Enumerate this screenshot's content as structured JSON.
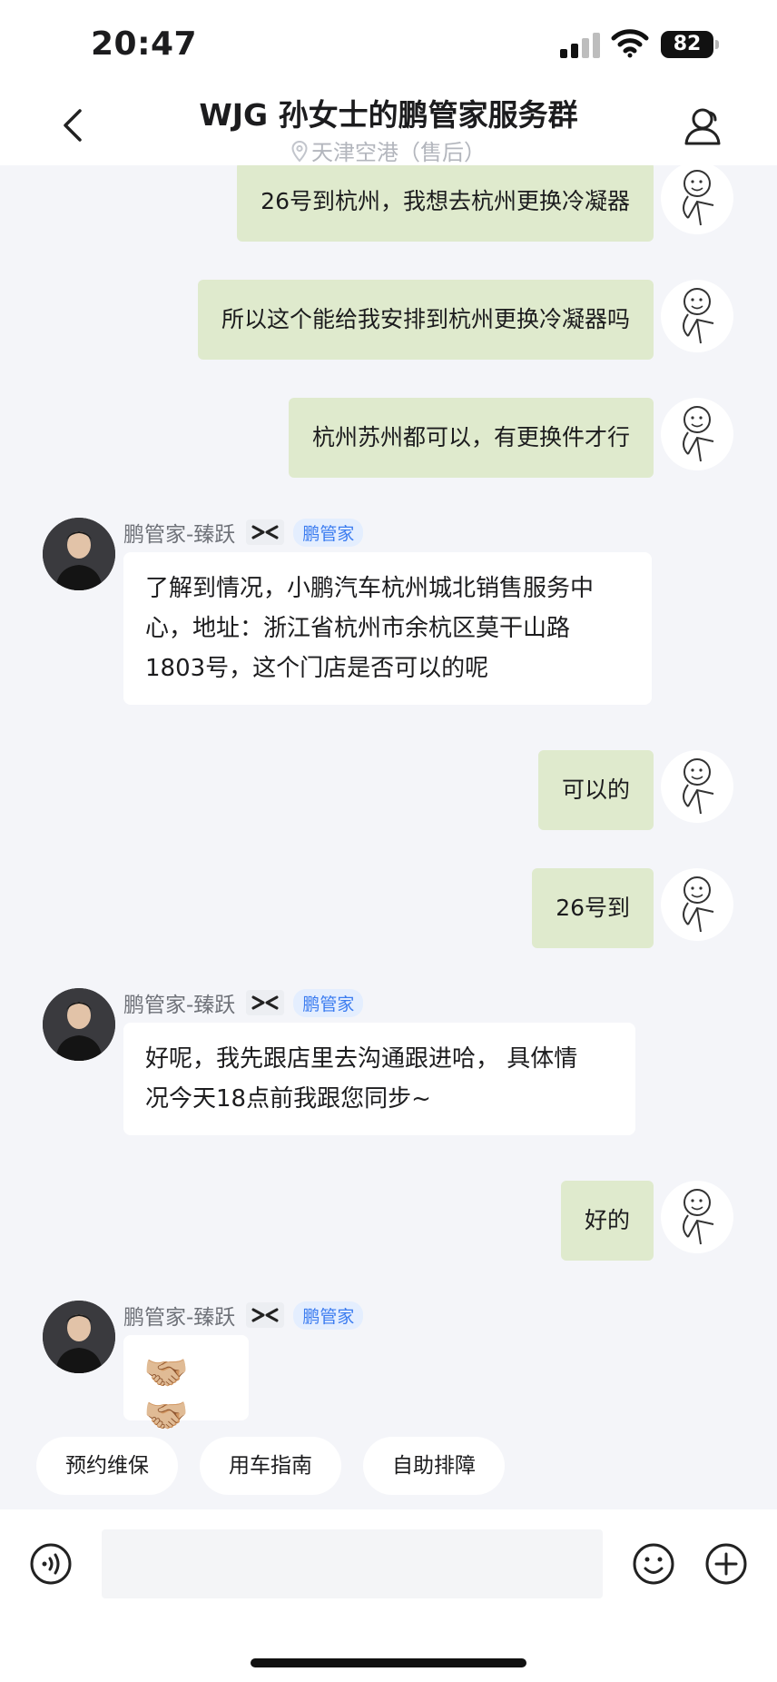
{
  "status_bar": {
    "time": "20:47",
    "battery": "82"
  },
  "header": {
    "title": "WJG 孙女士的鹏管家服务群",
    "subtitle": "天津空港（售后）",
    "icons": {
      "back": "chevron-left-icon",
      "members": "person-icon",
      "location": "location-pin-icon"
    }
  },
  "messages": [
    {
      "from": "me",
      "text": "26号到杭州，我想去杭州更换冷凝器"
    },
    {
      "from": "me",
      "text": "所以这个能给我安排到杭州更换冷凝器吗"
    },
    {
      "from": "me",
      "text": "杭州苏州都可以，有更换件才行"
    },
    {
      "from": "agent",
      "sender": "鹏管家-臻跃",
      "badge": "鹏管家",
      "lines": [
        "了解到情况，小鹏汽车杭州城北销售服务中",
        "心，地址：浙江省杭州市余杭区莫干山路",
        "1803号，这个门店是否可以的呢"
      ]
    },
    {
      "from": "me",
      "text": "可以的"
    },
    {
      "from": "me",
      "text": "26号到"
    },
    {
      "from": "agent",
      "sender": "鹏管家-臻跃",
      "badge": "鹏管家",
      "lines": [
        "好呢，我先跟店里去沟通跟进哈， 具体情",
        "况今天18点前我跟您同步~"
      ]
    },
    {
      "from": "me",
      "text": "好的"
    },
    {
      "from": "agent",
      "sender": "鹏管家-臻跃",
      "badge": "鹏管家",
      "emoji": "🤝🏼🤝🏼"
    }
  ],
  "quick_actions": [
    "预约维保",
    "用车指南",
    "自助排障"
  ],
  "input": {
    "placeholder": ""
  },
  "colors": {
    "outgoing_bubble": "#dfeacd",
    "incoming_bubble": "#ffffff",
    "background": "#f4f5f9",
    "badge_text": "#3b7cf0"
  }
}
